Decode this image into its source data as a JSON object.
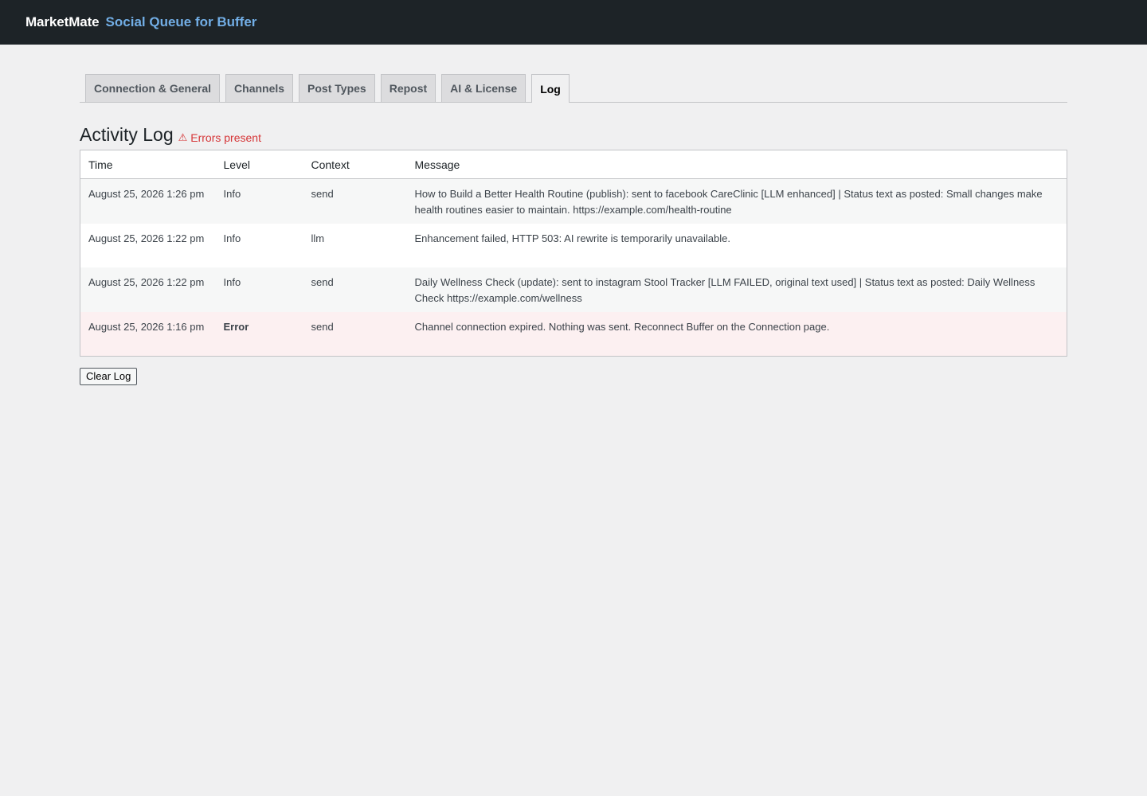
{
  "header": {
    "brand": "MarketMate",
    "product": "Social Queue for Buffer"
  },
  "tabs": [
    {
      "label": "Connection & General",
      "active": false
    },
    {
      "label": "Channels",
      "active": false
    },
    {
      "label": "Post Types",
      "active": false
    },
    {
      "label": "Repost",
      "active": false
    },
    {
      "label": "AI & License",
      "active": false
    },
    {
      "label": "Log",
      "active": true
    }
  ],
  "page": {
    "title": "Activity Log",
    "errors_flag": "Errors present",
    "errors_icon": "warning-triangle-icon",
    "errors_color": "#d63638"
  },
  "table": {
    "columns": [
      "Time",
      "Level",
      "Context",
      "Message"
    ],
    "rows": [
      {
        "time": "August 25, 2026 1:26 pm",
        "level": "Info",
        "context": "send",
        "message": "How to Build a Better Health Routine (publish): sent to facebook CareClinic [LLM enhanced] | Status text as posted: Small changes make health routines easier to maintain. https://example.com/health-routine"
      },
      {
        "time": "August 25, 2026 1:22 pm",
        "level": "Info",
        "context": "llm",
        "message": "Enhancement failed, HTTP 503: AI rewrite is temporarily unavailable."
      },
      {
        "time": "August 25, 2026 1:22 pm",
        "level": "Info",
        "context": "send",
        "message": "Daily Wellness Check (update): sent to instagram Stool Tracker [LLM FAILED, original text used] | Status text as posted: Daily Wellness Check https://example.com/wellness"
      },
      {
        "time": "August 25, 2026 1:16 pm",
        "level": "Error",
        "context": "send",
        "message": "Channel connection expired. Nothing was sent. Reconnect Buffer on the Connection page."
      }
    ]
  },
  "actions": {
    "clear_log": "Clear Log"
  }
}
